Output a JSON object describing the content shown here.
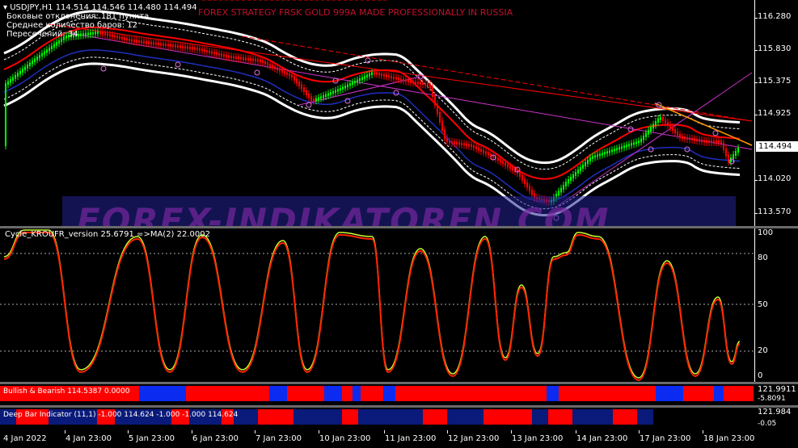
{
  "main": {
    "symbol_line": "USDJPY,H1  114.514 114.546 114.480 114.494",
    "info_lines": [
      "Боковые отклонения: 181 пункта",
      "Среднее количество баров: 12",
      "Пересечений: 34"
    ],
    "strategy_title": "FOREX STRATEGY FRSK GOLD 999A MADE PROFESSIONALLY IN RUSSIA",
    "price_ticks": [
      "116.280",
      "115.830",
      "115.375",
      "114.925",
      "114.020",
      "113.570"
    ],
    "current_price": "114.494",
    "watermark": "FOREX-INDIKATOREN.COM"
  },
  "oscillator": {
    "label": "Cycle_KROUFR_version 25.6791  =>MA(2) 22.0002",
    "ticks": [
      "100",
      "80",
      "50",
      "20",
      "0"
    ]
  },
  "bullish_bearish": {
    "label": "Bullish & Bearish 114.5387 0.0000",
    "axis_top": "121.9911",
    "axis_bottom": "-5.8091",
    "segments": [
      "red",
      "blue",
      "red",
      "blue",
      "red",
      "blue",
      "red",
      "blue",
      "red",
      "blue",
      "red",
      "red",
      "blue",
      "red",
      "red",
      "blue",
      "red",
      "blue",
      "red"
    ]
  },
  "deep_bar": {
    "label": "Deep Bar Indicator (11,1) -1.000 114.624 -1.000 -1.000 114.624",
    "axis_top": "121.984",
    "axis_bottom": "-0.05",
    "segments": [
      "blue",
      "red",
      "blue",
      "red",
      "blue",
      "red",
      "blue",
      "red",
      "blue",
      "red",
      "blue",
      "red",
      "blue",
      "red",
      "blue",
      "red",
      "blue",
      "red",
      "blue",
      "red",
      "blue"
    ]
  },
  "dates": [
    "4 Jan 2022",
    "4 Jan 23:00",
    "5 Jan 23:00",
    "6 Jan 23:00",
    "7 Jan 23:00",
    "10 Jan 23:00",
    "11 Jan 23:00",
    "12 Jan 23:00",
    "13 Jan 23:00",
    "14 Jan 23:00",
    "17 Jan 23:00",
    "18 Jan 23:00"
  ],
  "colors": {
    "bull_candle": "#00ff00",
    "bear_candle": "#ff0000",
    "envelope": "#ffffff",
    "ma_red": "#ff0000",
    "ma_blue": "#1e2fbf",
    "trend_magenta": "#cc33cc",
    "trend_orange": "#ff9900",
    "osc_fast": "#ff2200",
    "osc_slow": "#c8ff30",
    "strip_red": "#ff0000",
    "strip_blue": "#0b2cf0",
    "deep_blue": "#0a1a7a"
  }
}
